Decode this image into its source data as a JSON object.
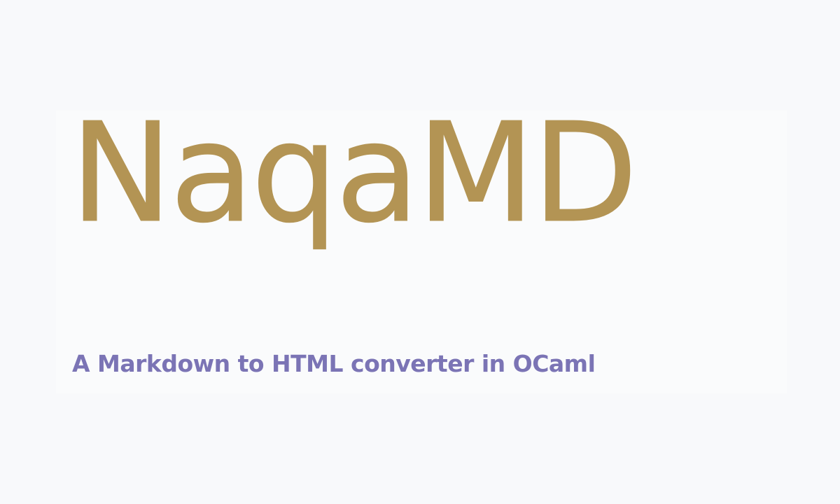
{
  "title": "NaqaMD",
  "subtitle": "A Markdown to HTML converter in OCaml",
  "colors": {
    "background": "#f8f9fb",
    "title": "#b39454",
    "subtitle": "#7b74b5"
  }
}
